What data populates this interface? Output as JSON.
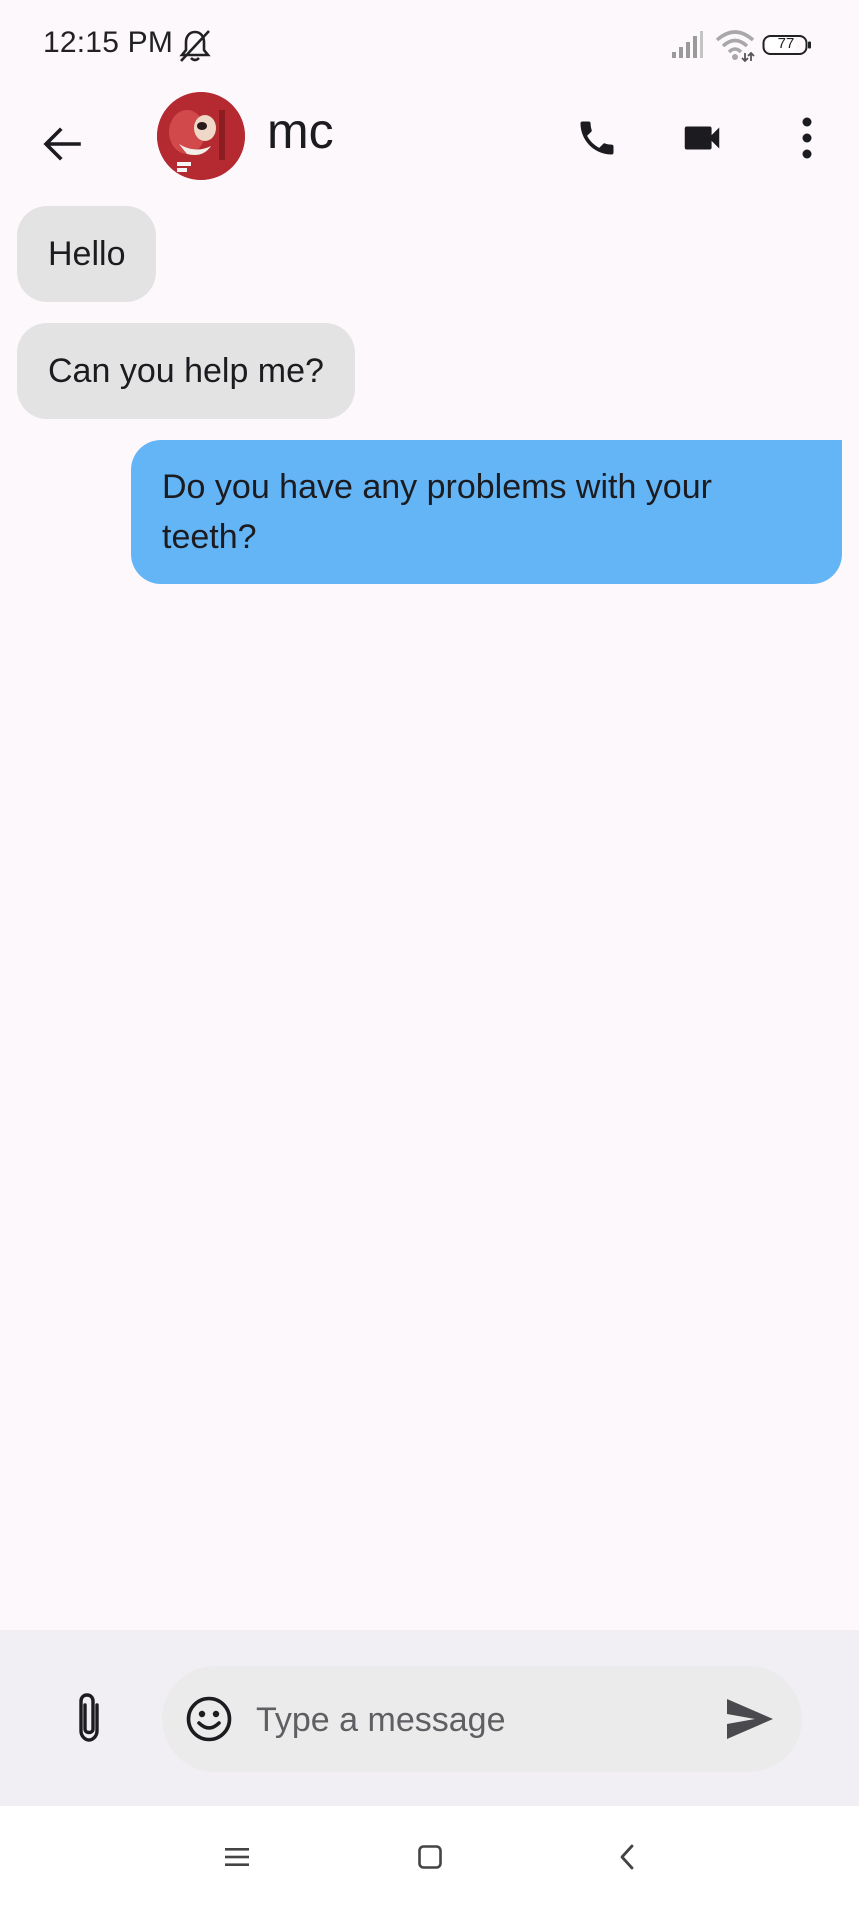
{
  "status_bar": {
    "time": "12:15 PM",
    "battery_level": "77",
    "icons": [
      "mute-icon",
      "signal-icon",
      "wifi-icon",
      "battery-icon"
    ]
  },
  "header": {
    "contact_name": "mc",
    "icons": [
      "back-arrow-icon",
      "avatar",
      "phone-icon",
      "video-camera-icon",
      "more-vert-icon"
    ]
  },
  "messages": [
    {
      "direction": "incoming",
      "text": "Hello"
    },
    {
      "direction": "incoming",
      "text": "Can you help me?"
    },
    {
      "direction": "outgoing",
      "text": "Do you have any problems with your teeth?"
    }
  ],
  "composer": {
    "placeholder": "Type a message",
    "value": "",
    "icons": [
      "attach-icon",
      "emoji-icon",
      "send-icon"
    ]
  },
  "nav_bar": {
    "icons": [
      "menu-icon",
      "home-icon",
      "back-icon"
    ]
  },
  "colors": {
    "background": "#fdf8fc",
    "incoming_bubble": "#e3e3e3",
    "outgoing_bubble": "#64b5f6",
    "composer_bg": "#f2eff4",
    "input_bg": "#ebebeb"
  }
}
